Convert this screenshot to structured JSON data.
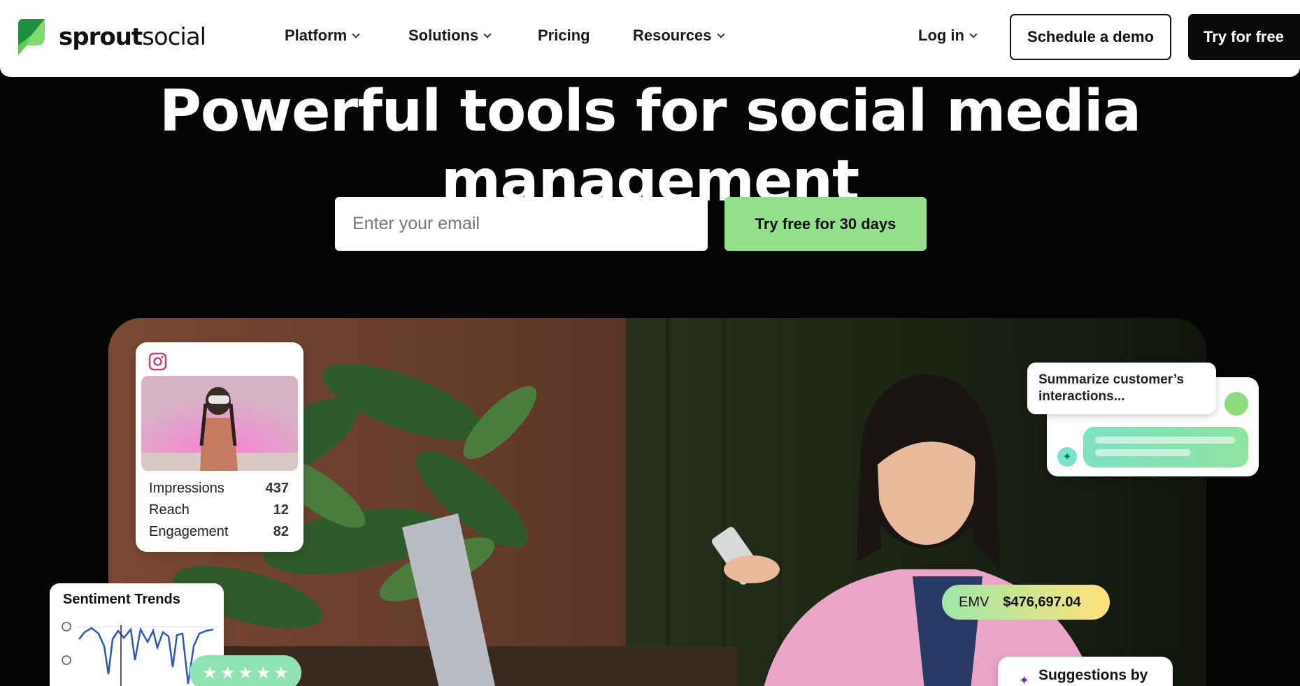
{
  "brand": {
    "name_bold": "sprout",
    "name_light": "social",
    "mark_color": "#59cb59"
  },
  "nav": {
    "items": [
      {
        "label": "Platform",
        "has_dropdown": true
      },
      {
        "label": "Solutions",
        "has_dropdown": true
      },
      {
        "label": "Pricing",
        "has_dropdown": false
      },
      {
        "label": "Resources",
        "has_dropdown": true
      }
    ],
    "login": "Log in",
    "demo": "Schedule a demo",
    "try_free": "Try for free"
  },
  "hero": {
    "title": "Powerful tools for social media management",
    "email_placeholder": "Enter your email",
    "cta": "Try free for 30 days",
    "cta_color": "#92e08a"
  },
  "instagram_card": {
    "icon": "instagram-icon",
    "metrics": [
      {
        "label": "Impressions",
        "value": "437"
      },
      {
        "label": "Reach",
        "value": "12"
      },
      {
        "label": "Engagement",
        "value": "82"
      }
    ]
  },
  "sentiment_card": {
    "title": "Sentiment Trends",
    "rating_stars": 5
  },
  "ai_card": {
    "prompt": "Summarize customer’s interactions..."
  },
  "emv_badge": {
    "label": "EMV",
    "amount": "$476,697.04"
  },
  "suggestions_card": {
    "title": "Suggestions by"
  }
}
